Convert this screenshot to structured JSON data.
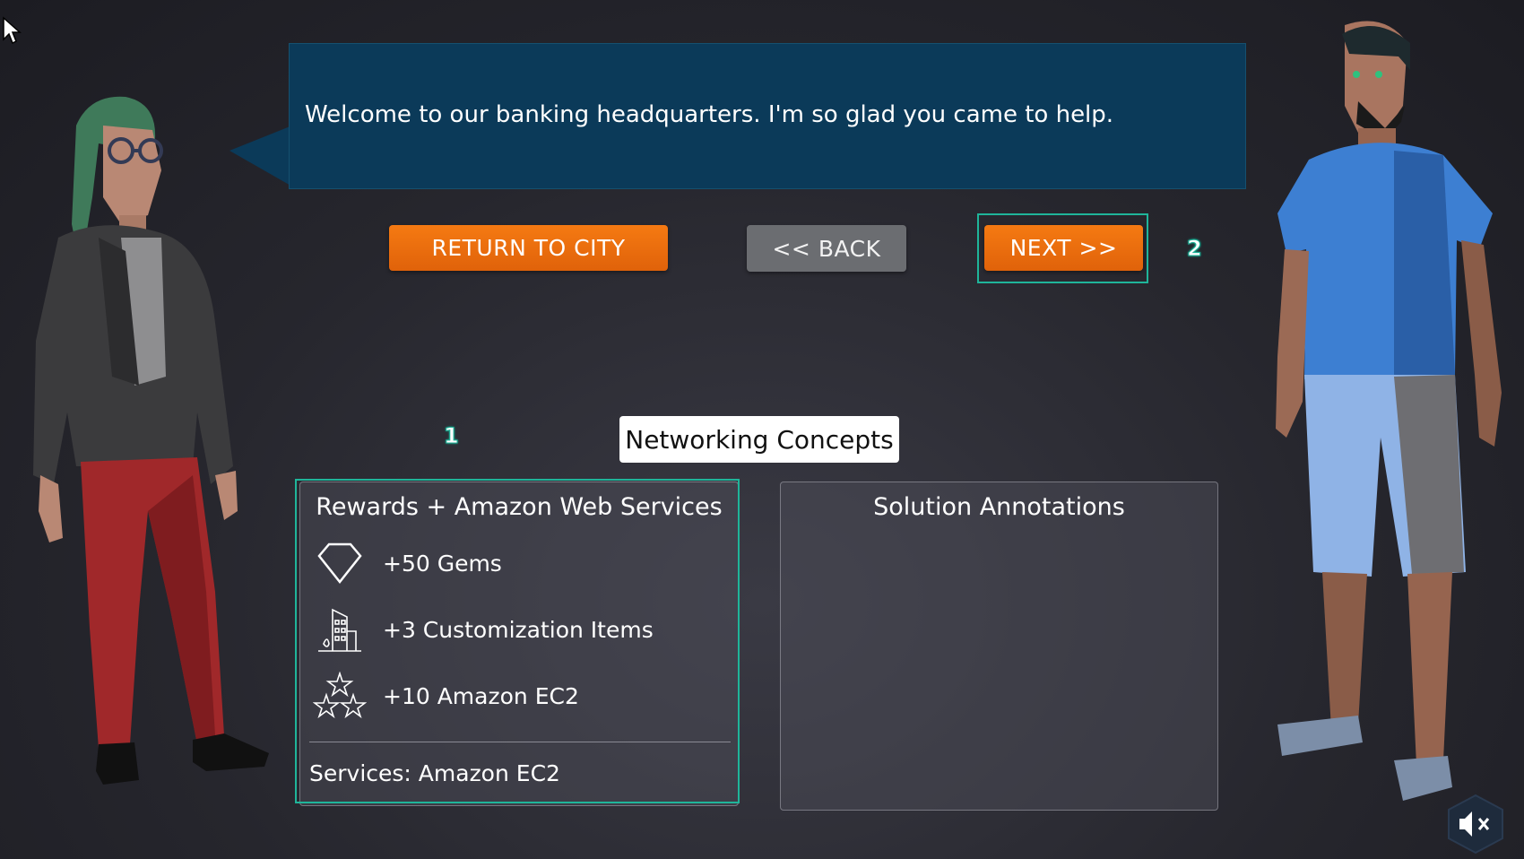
{
  "dialog": {
    "message": "Welcome to our banking headquarters. I'm so glad you came to help."
  },
  "buttons": {
    "return_label": "RETURN TO CITY",
    "back_label": "<< BACK",
    "next_label": "NEXT >>"
  },
  "markers": {
    "rewards_marker": "1",
    "next_marker": "2"
  },
  "topic": {
    "title": "Networking Concepts"
  },
  "rewards_panel": {
    "title": "Rewards + Amazon Web Services",
    "items": [
      {
        "icon": "diamond-icon",
        "label": "+50 Gems"
      },
      {
        "icon": "buildings-icon",
        "label": "+3 Customization Items"
      },
      {
        "icon": "stars-icon",
        "label": "+10 Amazon EC2"
      }
    ],
    "services": "Services: Amazon EC2"
  },
  "solution_panel": {
    "title": "Solution Annotations"
  },
  "colors": {
    "accent_orange": "#f26d0c",
    "highlight_teal": "#1fb59a",
    "bubble_navy": "#0b3a59"
  },
  "sound": {
    "icon": "mute-speaker-icon"
  }
}
